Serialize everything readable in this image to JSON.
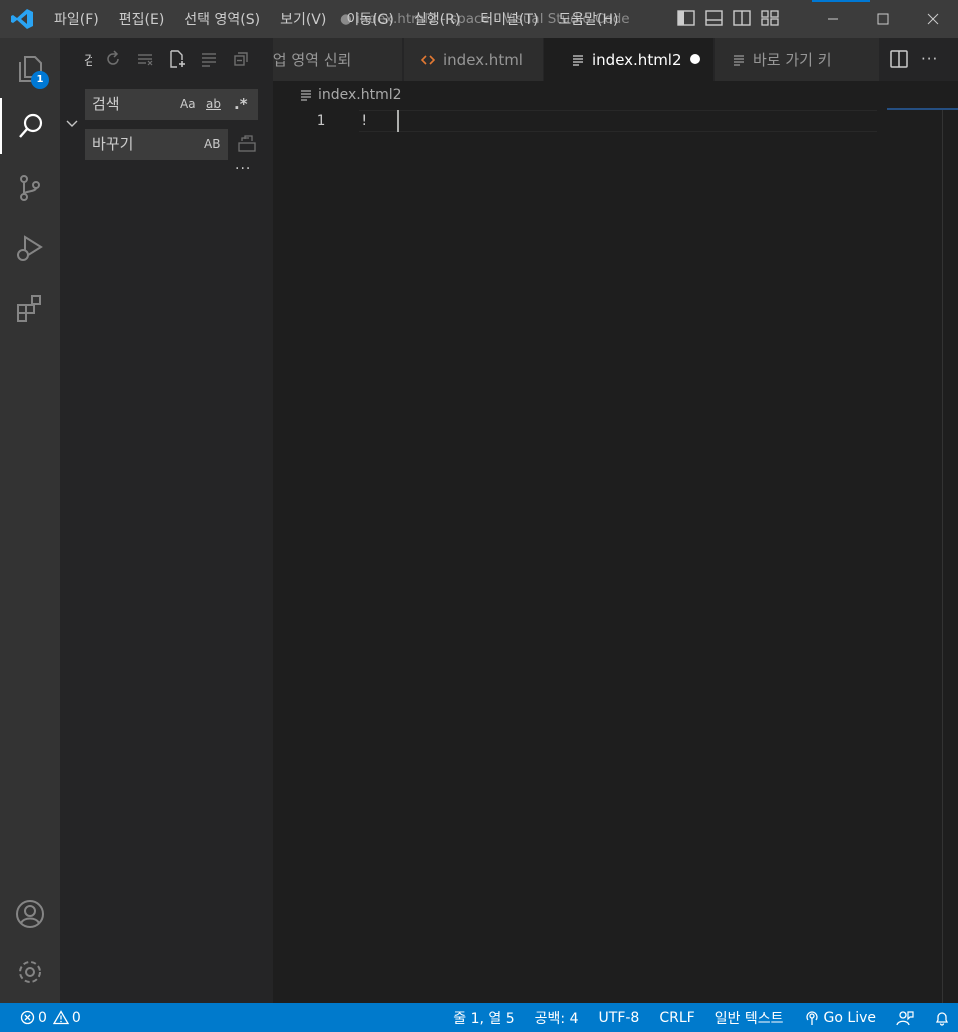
{
  "titlebar": {
    "menu": [
      "파일(F)",
      "편집(E)",
      "선택 영역(S)",
      "보기(V)",
      "이동(G)",
      "실행(R)",
      "터미널(T)",
      "도움말(H)"
    ],
    "window_title": "● index.html2 - space - Visual Studio Code"
  },
  "activitybar": {
    "explorer_badge": "1"
  },
  "sidebar": {
    "title": "검",
    "search_placeholder": "검색",
    "match_case": "Aa",
    "whole_word": "ab",
    "regex": ".*",
    "replace_placeholder": "바꾸기",
    "preserve_case": "AB",
    "more": "···"
  },
  "tabs": [
    {
      "label": "작업 영역 신뢰"
    },
    {
      "label": "index.html"
    },
    {
      "label": "index.html2"
    },
    {
      "label": "바로 가기 키"
    }
  ],
  "breadcrumb": {
    "file": "index.html2"
  },
  "editor": {
    "line_number": "1",
    "code": "!"
  },
  "statusbar": {
    "errors": "0",
    "warnings": "0",
    "position": "줄 1, 열 5",
    "spaces": "공백: 4",
    "encoding": "UTF-8",
    "eol": "CRLF",
    "language": "일반 텍스트",
    "golive": "Go Live"
  },
  "colors": {
    "accent": "#007acc",
    "titlebar": "#3c3c3c",
    "activitybar": "#333333",
    "sidebar": "#252526",
    "editor": "#1e1e1e"
  }
}
